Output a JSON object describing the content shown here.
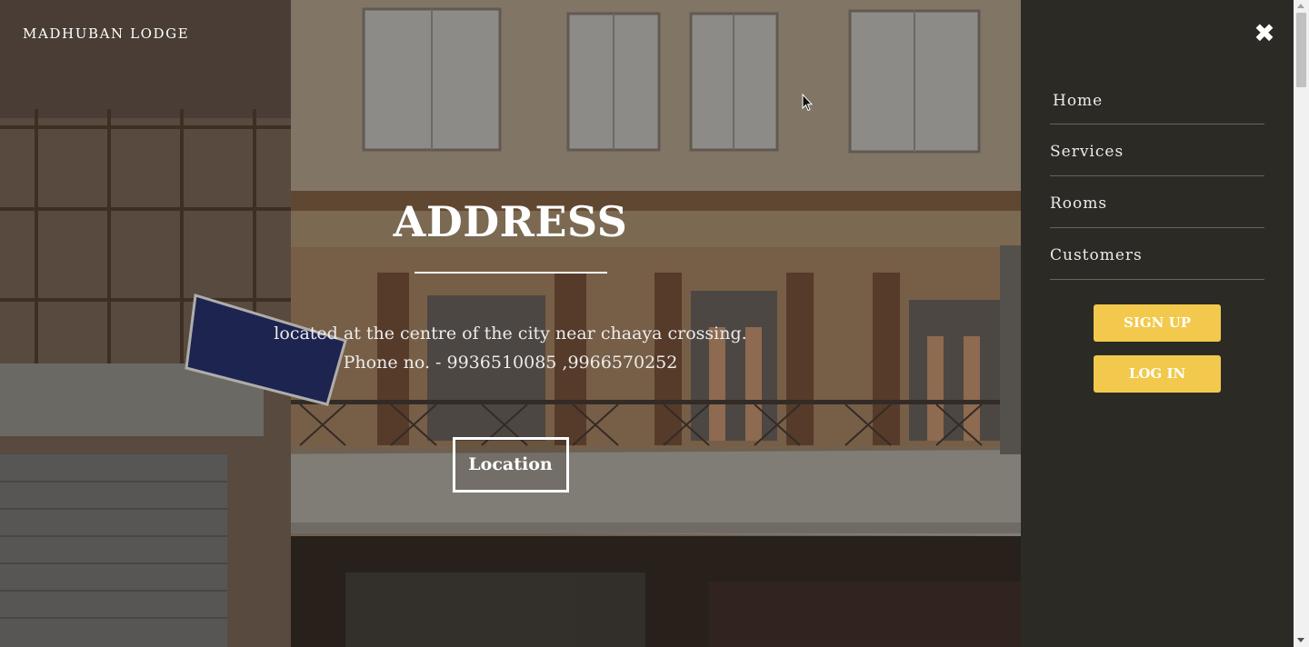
{
  "brand": "MADHUBAN LODGE",
  "hero": {
    "title": "ADDRESS",
    "line1": "located at the centre of the city near chaaya crossing.",
    "line2": "Phone no. - 9936510085 ,9966570252",
    "button": "Location"
  },
  "menu": {
    "close_icon": "close-icon",
    "items": [
      {
        "label": "Home"
      },
      {
        "label": "Services"
      },
      {
        "label": "Rooms"
      },
      {
        "label": "Customers"
      }
    ],
    "signup": "SIGN UP",
    "login": "LOG IN"
  },
  "colors": {
    "accent": "#f2c94c",
    "sidebar": "#2b2a25",
    "divider": "#6b6550"
  }
}
